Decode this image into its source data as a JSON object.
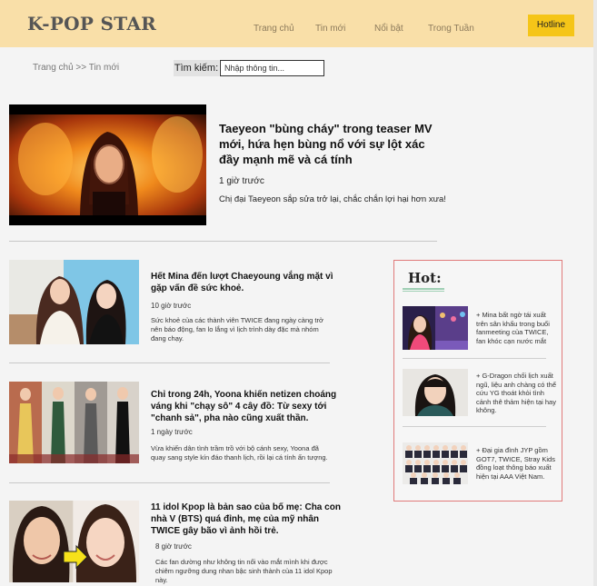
{
  "header": {
    "brand": "K-POP STAR",
    "nav": [
      "Trang chủ",
      "Tin mới",
      "Nổi bật",
      "Trong Tuần"
    ],
    "hotline": "Hotline",
    "colors": {
      "background": "#f9dfa8",
      "button": "#f5c518"
    }
  },
  "breadcrumb": "Trang chủ >> Tin mới",
  "search": {
    "label": "Tìm kiếm:",
    "placeholder": "Nhập thông tin..."
  },
  "featured": {
    "title": "Taeyeon \"bùng cháy\" trong teaser MV mới, hứa hẹn bùng nổ với sự lột xác đầy mạnh mẽ và cá tính",
    "time": "1 giờ trước",
    "description": "Chị đại Taeyeon sắp sửa trở lại, chắc chắn lợi hại hơn xưa!"
  },
  "articles": [
    {
      "title": "Hết Mina đến lượt Chaeyoung vắng mặt vì gặp vấn đề sức khoẻ.",
      "time": "10 giờ trước",
      "description": "Sức khoẻ của các thành viên TWICE đang ngày càng trở nên báo động, fan lo lắng vì lịch trình dày đặc mà nhóm đang chạy."
    },
    {
      "title": "Chỉ trong 24h, Yoona khiến netizen choáng váng khi \"chạy sô\" 4 cây đồ: Từ sexy tới \"chanh sả\", pha nào cũng xuất thần.",
      "time": "1 ngày trước",
      "description": "Vừa khiến dân tình trầm trồ với bộ cánh sexy, Yoona đã quay sang style kín đáo thanh lịch, rồi lại cá tính ấn tượng."
    },
    {
      "title": "11 idol Kpop là bản sao của bố mẹ: Cha con nhà V (BTS) quá đỉnh, mẹ của mỹ nhân TWICE gây bão vì ảnh hồi trẻ.",
      "time": "8 giờ trước",
      "description": "Các fan dường như không tin nổi vào mắt mình khi được chiêm ngưỡng dung nhan bậc sinh thành của 11 idol Kpop này."
    }
  ],
  "hot": {
    "title": "Hot:",
    "items": [
      {
        "text": "+ Mina bất ngờ tái xuất trên sân khấu trong buổi fanmeeting của TWICE, fan khóc cạn nước mắt"
      },
      {
        "text": "+ G-Dragon chối lịch xuất ngũ, liệu anh chàng có thể cứu YG thoát khỏi tình cảnh thê thảm hiện tại hay không."
      },
      {
        "text": "+ Đại gia đình JYP gồm GOT7, TWICE, Stray Kids đồng loạt thông báo xuất hiện tại AAA Việt Nam."
      }
    ],
    "colors": {
      "border": "#e07a7a",
      "underline": "#9fcfb4"
    }
  }
}
